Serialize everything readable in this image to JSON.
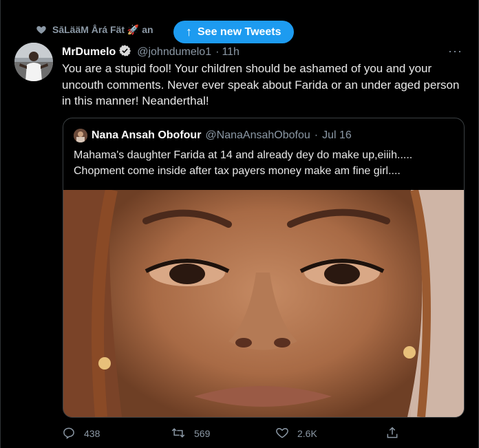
{
  "social_context": {
    "text": "SāLääM Årá Fät 🚀 an"
  },
  "new_tweets_pill": {
    "label": "See new Tweets",
    "arrow": "↑"
  },
  "tweet": {
    "author_name": "MrDumelo",
    "handle": "@johndumelo1",
    "separator": "·",
    "time": "11h",
    "more": "···",
    "text": "You are a stupid fool! Your children should be ashamed of you and your uncouth comments. Never ever speak about Farida or an under aged person in this manner! Neanderthal!"
  },
  "quote": {
    "author_name": "Nana Ansah Obofour",
    "handle": "@NanaAnsahObofou",
    "separator": "·",
    "date": "Jul 16",
    "text": "Mahama's daughter Farida at 14 and already dey do make up,eiiih..... Chopment come inside after tax payers money make am fine girl...."
  },
  "actions": {
    "replies": "438",
    "retweets": "569",
    "likes": "2.6K"
  },
  "colors": {
    "accent": "#1d9bf0",
    "muted": "#8b98a5",
    "background": "#000000"
  },
  "icons": [
    "heart-icon",
    "verified-badge-icon",
    "reply-icon",
    "retweet-icon",
    "like-icon",
    "share-icon",
    "more-icon"
  ]
}
